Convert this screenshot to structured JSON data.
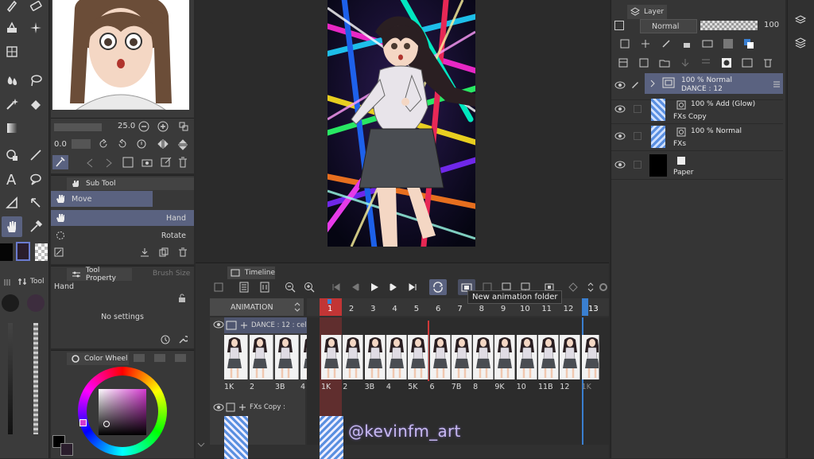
{
  "colors": {
    "accent": "#5a6280",
    "playhead": "#d03838",
    "frame_marker": "#3a7fd0"
  },
  "nav": {
    "zoom": "25.0",
    "angle": "0.0"
  },
  "subtool": {
    "title": "Sub Tool",
    "group": "Move",
    "items": [
      {
        "label": "Hand"
      },
      {
        "label": "Rotate"
      }
    ]
  },
  "toolprop": {
    "title": "Tool Property",
    "tab2": "Brush Size",
    "tool_name": "Hand",
    "empty": "No settings"
  },
  "colorwheel": {
    "title": "Color Wheel"
  },
  "left_strip": {
    "label": "Tool"
  },
  "layer_panel": {
    "title": "Layer",
    "blend": "Normal",
    "opacity": "100",
    "layers": [
      {
        "opacity_mode": "100 %  Normal",
        "name": "DANCE : 12",
        "selected": true
      },
      {
        "opacity_mode": "100 %  Add (Glow)",
        "name": "FXs Copy",
        "selected": false
      },
      {
        "opacity_mode": "100 %  Normal",
        "name": "FXs",
        "selected": false
      },
      {
        "opacity_mode": "",
        "name": "Paper",
        "selected": false
      }
    ]
  },
  "timeline": {
    "title": "Timeline",
    "track_name": "ANIMATION",
    "tooltip": "New animation folder",
    "frame_start": "1",
    "frame_end": "13",
    "frame_numbers": [
      "2",
      "3",
      "4",
      "5",
      "6",
      "7",
      "8",
      "9",
      "10",
      "11",
      "12"
    ],
    "left_cel_labels": [
      "1K",
      "2",
      "3B",
      "4"
    ],
    "cel_labels": [
      "1K",
      "2",
      "3B",
      "4",
      "5K",
      "6",
      "7B",
      "8",
      "9K",
      "10",
      "11B",
      "12",
      "1K"
    ],
    "tracks": [
      {
        "name": "DANCE : 12 : cel"
      },
      {
        "name": "FXs Copy :"
      }
    ]
  },
  "watermark": "@kevinfm_art"
}
